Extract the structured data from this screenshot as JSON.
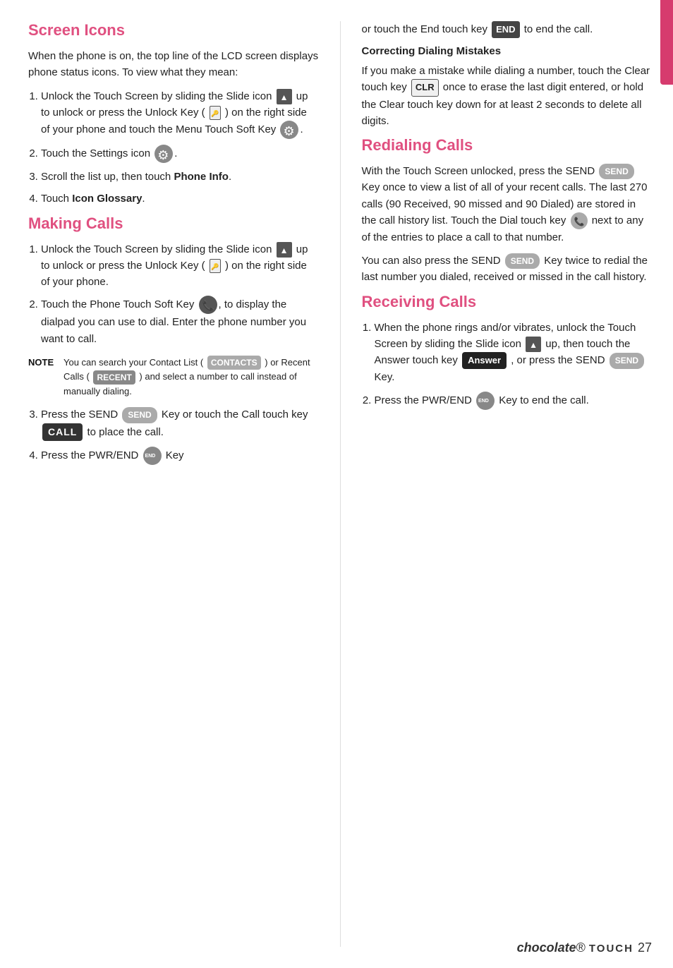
{
  "page": {
    "number": "27"
  },
  "footer": {
    "brand": "chocolate",
    "touch": "TOUCH",
    "page": "27"
  },
  "left": {
    "screen_icons": {
      "title": "Screen Icons",
      "intro": "When the phone is on, the top line of the LCD screen displays phone status icons. To view what they mean:",
      "steps": [
        "Unlock the Touch Screen by sliding the Slide icon  up to unlock or press the Unlock Key (  ) on the right side of your phone and touch the Menu Touch Soft Key  .",
        "Touch the Settings icon  .",
        "Scroll the list up, then touch Phone Info.",
        "Touch Icon Glossary."
      ],
      "step3_bold": "Phone Info",
      "step4_bold": "Icon Glossary"
    },
    "making_calls": {
      "title": "Making Calls",
      "steps": [
        "Unlock the Touch Screen by sliding the Slide icon  up to unlock or press the Unlock Key (  ) on the right side of your phone.",
        "Touch the Phone Touch Soft Key  , to display the dialpad you can use to dial. Enter the phone number you want to call.",
        "Press the SEND  Key or touch the Call touch key  to place the call.",
        "Press the PWR/END   Key"
      ],
      "note_label": "NOTE",
      "note_text": "You can search your Contact List (  ) or Recent Calls (  ) and select a number to call instead of manually dialing."
    }
  },
  "right": {
    "end_call": {
      "text": "or touch the End touch key",
      "end_badge": "END",
      "text2": "to end the call."
    },
    "correcting": {
      "title": "Correcting Dialing Mistakes",
      "body": "If you make a mistake while dialing a number, touch the Clear touch key  once to erase the last digit entered, or hold the Clear touch key down for at least 2 seconds to delete all digits.",
      "clr_badge": "CLR"
    },
    "redialing": {
      "title": "Redialing Calls",
      "body1": "With the Touch Screen unlocked, press the SEND  Key once to view a list of all of your recent calls. The last 270 calls (90 Received, 90 missed and 90 Dialed) are stored in the call history list. Touch the Dial touch key  next to any of the entries to place a call to that number.",
      "body2": "You can also press the SEND  Key twice to redial the last number you dialed, received or missed in the call history."
    },
    "receiving": {
      "title": "Receiving Calls",
      "steps": [
        "When the phone rings and/or vibrates, unlock the Touch Screen by sliding the Slide icon  up, then touch the Answer touch key  , or press the SEND  Key.",
        "Press the PWR/END   Key to end the call."
      ],
      "answer_badge": "Answer"
    }
  }
}
